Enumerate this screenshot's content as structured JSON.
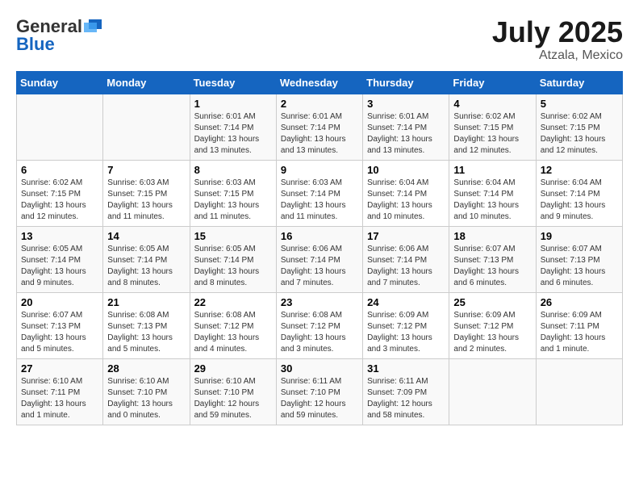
{
  "logo": {
    "general": "General",
    "blue": "Blue"
  },
  "title": "July 2025",
  "subtitle": "Atzala, Mexico",
  "headers": [
    "Sunday",
    "Monday",
    "Tuesday",
    "Wednesday",
    "Thursday",
    "Friday",
    "Saturday"
  ],
  "weeks": [
    [
      {
        "day": "",
        "detail": ""
      },
      {
        "day": "",
        "detail": ""
      },
      {
        "day": "1",
        "detail": "Sunrise: 6:01 AM\nSunset: 7:14 PM\nDaylight: 13 hours\nand 13 minutes."
      },
      {
        "day": "2",
        "detail": "Sunrise: 6:01 AM\nSunset: 7:14 PM\nDaylight: 13 hours\nand 13 minutes."
      },
      {
        "day": "3",
        "detail": "Sunrise: 6:01 AM\nSunset: 7:14 PM\nDaylight: 13 hours\nand 13 minutes."
      },
      {
        "day": "4",
        "detail": "Sunrise: 6:02 AM\nSunset: 7:15 PM\nDaylight: 13 hours\nand 12 minutes."
      },
      {
        "day": "5",
        "detail": "Sunrise: 6:02 AM\nSunset: 7:15 PM\nDaylight: 13 hours\nand 12 minutes."
      }
    ],
    [
      {
        "day": "6",
        "detail": "Sunrise: 6:02 AM\nSunset: 7:15 PM\nDaylight: 13 hours\nand 12 minutes."
      },
      {
        "day": "7",
        "detail": "Sunrise: 6:03 AM\nSunset: 7:15 PM\nDaylight: 13 hours\nand 11 minutes."
      },
      {
        "day": "8",
        "detail": "Sunrise: 6:03 AM\nSunset: 7:15 PM\nDaylight: 13 hours\nand 11 minutes."
      },
      {
        "day": "9",
        "detail": "Sunrise: 6:03 AM\nSunset: 7:14 PM\nDaylight: 13 hours\nand 11 minutes."
      },
      {
        "day": "10",
        "detail": "Sunrise: 6:04 AM\nSunset: 7:14 PM\nDaylight: 13 hours\nand 10 minutes."
      },
      {
        "day": "11",
        "detail": "Sunrise: 6:04 AM\nSunset: 7:14 PM\nDaylight: 13 hours\nand 10 minutes."
      },
      {
        "day": "12",
        "detail": "Sunrise: 6:04 AM\nSunset: 7:14 PM\nDaylight: 13 hours\nand 9 minutes."
      }
    ],
    [
      {
        "day": "13",
        "detail": "Sunrise: 6:05 AM\nSunset: 7:14 PM\nDaylight: 13 hours\nand 9 minutes."
      },
      {
        "day": "14",
        "detail": "Sunrise: 6:05 AM\nSunset: 7:14 PM\nDaylight: 13 hours\nand 8 minutes."
      },
      {
        "day": "15",
        "detail": "Sunrise: 6:05 AM\nSunset: 7:14 PM\nDaylight: 13 hours\nand 8 minutes."
      },
      {
        "day": "16",
        "detail": "Sunrise: 6:06 AM\nSunset: 7:14 PM\nDaylight: 13 hours\nand 7 minutes."
      },
      {
        "day": "17",
        "detail": "Sunrise: 6:06 AM\nSunset: 7:14 PM\nDaylight: 13 hours\nand 7 minutes."
      },
      {
        "day": "18",
        "detail": "Sunrise: 6:07 AM\nSunset: 7:13 PM\nDaylight: 13 hours\nand 6 minutes."
      },
      {
        "day": "19",
        "detail": "Sunrise: 6:07 AM\nSunset: 7:13 PM\nDaylight: 13 hours\nand 6 minutes."
      }
    ],
    [
      {
        "day": "20",
        "detail": "Sunrise: 6:07 AM\nSunset: 7:13 PM\nDaylight: 13 hours\nand 5 minutes."
      },
      {
        "day": "21",
        "detail": "Sunrise: 6:08 AM\nSunset: 7:13 PM\nDaylight: 13 hours\nand 5 minutes."
      },
      {
        "day": "22",
        "detail": "Sunrise: 6:08 AM\nSunset: 7:12 PM\nDaylight: 13 hours\nand 4 minutes."
      },
      {
        "day": "23",
        "detail": "Sunrise: 6:08 AM\nSunset: 7:12 PM\nDaylight: 13 hours\nand 3 minutes."
      },
      {
        "day": "24",
        "detail": "Sunrise: 6:09 AM\nSunset: 7:12 PM\nDaylight: 13 hours\nand 3 minutes."
      },
      {
        "day": "25",
        "detail": "Sunrise: 6:09 AM\nSunset: 7:12 PM\nDaylight: 13 hours\nand 2 minutes."
      },
      {
        "day": "26",
        "detail": "Sunrise: 6:09 AM\nSunset: 7:11 PM\nDaylight: 13 hours\nand 1 minute."
      }
    ],
    [
      {
        "day": "27",
        "detail": "Sunrise: 6:10 AM\nSunset: 7:11 PM\nDaylight: 13 hours\nand 1 minute."
      },
      {
        "day": "28",
        "detail": "Sunrise: 6:10 AM\nSunset: 7:10 PM\nDaylight: 13 hours\nand 0 minutes."
      },
      {
        "day": "29",
        "detail": "Sunrise: 6:10 AM\nSunset: 7:10 PM\nDaylight: 12 hours\nand 59 minutes."
      },
      {
        "day": "30",
        "detail": "Sunrise: 6:11 AM\nSunset: 7:10 PM\nDaylight: 12 hours\nand 59 minutes."
      },
      {
        "day": "31",
        "detail": "Sunrise: 6:11 AM\nSunset: 7:09 PM\nDaylight: 12 hours\nand 58 minutes."
      },
      {
        "day": "",
        "detail": ""
      },
      {
        "day": "",
        "detail": ""
      }
    ]
  ]
}
